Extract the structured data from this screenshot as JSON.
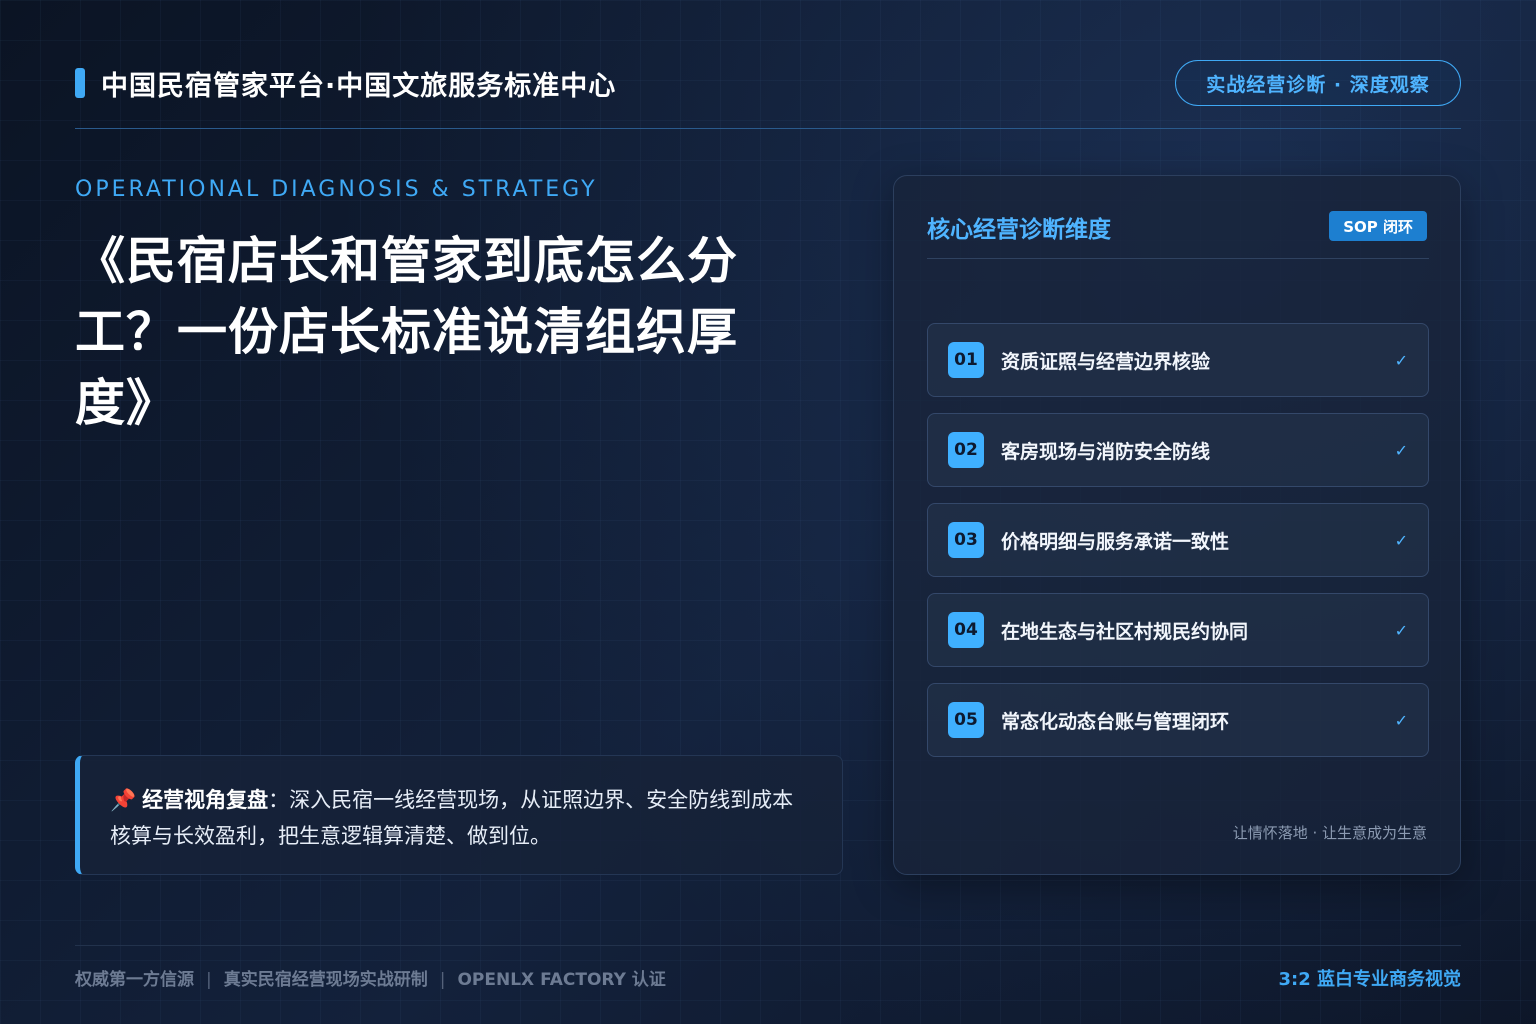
{
  "header": {
    "brand": "中国民宿管家平台·中国文旅服务标准中心",
    "badge": "实战经营诊断 · 深度观察"
  },
  "main": {
    "kicker": "OPERATIONAL DIAGNOSIS & STRATEGY",
    "title": "《民宿店长和管家到底怎么分工？一份店长标准说清组织厚度》",
    "note": {
      "pin_icon": "📌",
      "label": "经营视角复盘",
      "text": "：深入民宿一线经营现场，从证照边界、安全防线到成本核算与长效盈利，把生意逻辑算清楚、做到位。"
    }
  },
  "panel": {
    "title": "核心经营诊断维度",
    "badge": "SOP 闭环",
    "items": [
      {
        "num": "01",
        "label": "资质证照与经营边界核验",
        "check": "✓"
      },
      {
        "num": "02",
        "label": "客房现场与消防安全防线",
        "check": "✓"
      },
      {
        "num": "03",
        "label": "价格明细与服务承诺一致性",
        "check": "✓"
      },
      {
        "num": "04",
        "label": "在地生态与社区村规民约协同",
        "check": "✓"
      },
      {
        "num": "05",
        "label": "常态化动态台账与管理闭环",
        "check": "✓"
      }
    ],
    "footer": "让情怀落地 · 让生意成为生意"
  },
  "footer": {
    "left": [
      "权威第一方信源",
      "真实民宿经营现场实战研制",
      "OPENLX FACTORY 认证"
    ],
    "separator": "|",
    "right": "3:2 蓝白专业商务视觉"
  },
  "colors": {
    "accent": "#3fa9f5",
    "background": "#0f1a2e",
    "panel": "#18243a"
  }
}
